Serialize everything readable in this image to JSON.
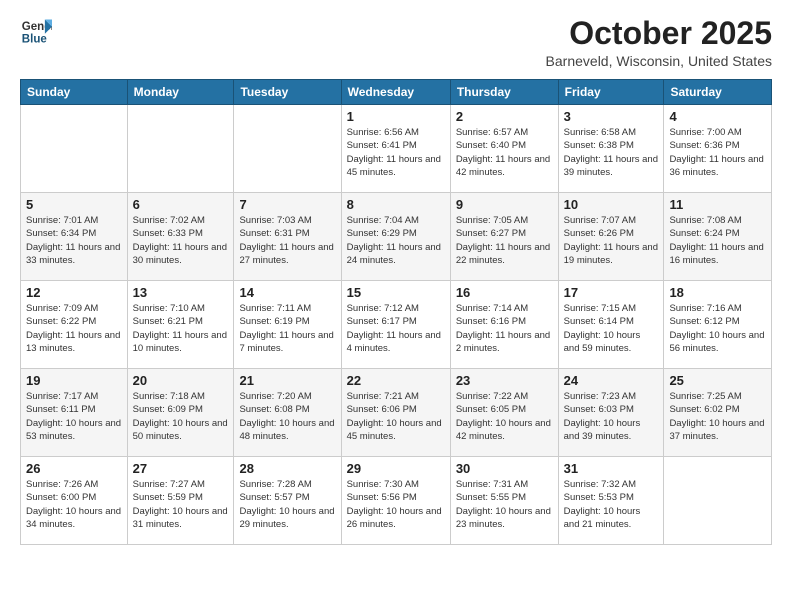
{
  "header": {
    "logo_general": "General",
    "logo_blue": "Blue",
    "month": "October 2025",
    "location": "Barneveld, Wisconsin, United States"
  },
  "days_of_week": [
    "Sunday",
    "Monday",
    "Tuesday",
    "Wednesday",
    "Thursday",
    "Friday",
    "Saturday"
  ],
  "weeks": [
    {
      "cells": [
        {
          "day": "",
          "info": ""
        },
        {
          "day": "",
          "info": ""
        },
        {
          "day": "",
          "info": ""
        },
        {
          "day": "1",
          "info": "Sunrise: 6:56 AM\nSunset: 6:41 PM\nDaylight: 11 hours and 45 minutes."
        },
        {
          "day": "2",
          "info": "Sunrise: 6:57 AM\nSunset: 6:40 PM\nDaylight: 11 hours and 42 minutes."
        },
        {
          "day": "3",
          "info": "Sunrise: 6:58 AM\nSunset: 6:38 PM\nDaylight: 11 hours and 39 minutes."
        },
        {
          "day": "4",
          "info": "Sunrise: 7:00 AM\nSunset: 6:36 PM\nDaylight: 11 hours and 36 minutes."
        }
      ]
    },
    {
      "cells": [
        {
          "day": "5",
          "info": "Sunrise: 7:01 AM\nSunset: 6:34 PM\nDaylight: 11 hours and 33 minutes."
        },
        {
          "day": "6",
          "info": "Sunrise: 7:02 AM\nSunset: 6:33 PM\nDaylight: 11 hours and 30 minutes."
        },
        {
          "day": "7",
          "info": "Sunrise: 7:03 AM\nSunset: 6:31 PM\nDaylight: 11 hours and 27 minutes."
        },
        {
          "day": "8",
          "info": "Sunrise: 7:04 AM\nSunset: 6:29 PM\nDaylight: 11 hours and 24 minutes."
        },
        {
          "day": "9",
          "info": "Sunrise: 7:05 AM\nSunset: 6:27 PM\nDaylight: 11 hours and 22 minutes."
        },
        {
          "day": "10",
          "info": "Sunrise: 7:07 AM\nSunset: 6:26 PM\nDaylight: 11 hours and 19 minutes."
        },
        {
          "day": "11",
          "info": "Sunrise: 7:08 AM\nSunset: 6:24 PM\nDaylight: 11 hours and 16 minutes."
        }
      ]
    },
    {
      "cells": [
        {
          "day": "12",
          "info": "Sunrise: 7:09 AM\nSunset: 6:22 PM\nDaylight: 11 hours and 13 minutes."
        },
        {
          "day": "13",
          "info": "Sunrise: 7:10 AM\nSunset: 6:21 PM\nDaylight: 11 hours and 10 minutes."
        },
        {
          "day": "14",
          "info": "Sunrise: 7:11 AM\nSunset: 6:19 PM\nDaylight: 11 hours and 7 minutes."
        },
        {
          "day": "15",
          "info": "Sunrise: 7:12 AM\nSunset: 6:17 PM\nDaylight: 11 hours and 4 minutes."
        },
        {
          "day": "16",
          "info": "Sunrise: 7:14 AM\nSunset: 6:16 PM\nDaylight: 11 hours and 2 minutes."
        },
        {
          "day": "17",
          "info": "Sunrise: 7:15 AM\nSunset: 6:14 PM\nDaylight: 10 hours and 59 minutes."
        },
        {
          "day": "18",
          "info": "Sunrise: 7:16 AM\nSunset: 6:12 PM\nDaylight: 10 hours and 56 minutes."
        }
      ]
    },
    {
      "cells": [
        {
          "day": "19",
          "info": "Sunrise: 7:17 AM\nSunset: 6:11 PM\nDaylight: 10 hours and 53 minutes."
        },
        {
          "day": "20",
          "info": "Sunrise: 7:18 AM\nSunset: 6:09 PM\nDaylight: 10 hours and 50 minutes."
        },
        {
          "day": "21",
          "info": "Sunrise: 7:20 AM\nSunset: 6:08 PM\nDaylight: 10 hours and 48 minutes."
        },
        {
          "day": "22",
          "info": "Sunrise: 7:21 AM\nSunset: 6:06 PM\nDaylight: 10 hours and 45 minutes."
        },
        {
          "day": "23",
          "info": "Sunrise: 7:22 AM\nSunset: 6:05 PM\nDaylight: 10 hours and 42 minutes."
        },
        {
          "day": "24",
          "info": "Sunrise: 7:23 AM\nSunset: 6:03 PM\nDaylight: 10 hours and 39 minutes."
        },
        {
          "day": "25",
          "info": "Sunrise: 7:25 AM\nSunset: 6:02 PM\nDaylight: 10 hours and 37 minutes."
        }
      ]
    },
    {
      "cells": [
        {
          "day": "26",
          "info": "Sunrise: 7:26 AM\nSunset: 6:00 PM\nDaylight: 10 hours and 34 minutes."
        },
        {
          "day": "27",
          "info": "Sunrise: 7:27 AM\nSunset: 5:59 PM\nDaylight: 10 hours and 31 minutes."
        },
        {
          "day": "28",
          "info": "Sunrise: 7:28 AM\nSunset: 5:57 PM\nDaylight: 10 hours and 29 minutes."
        },
        {
          "day": "29",
          "info": "Sunrise: 7:30 AM\nSunset: 5:56 PM\nDaylight: 10 hours and 26 minutes."
        },
        {
          "day": "30",
          "info": "Sunrise: 7:31 AM\nSunset: 5:55 PM\nDaylight: 10 hours and 23 minutes."
        },
        {
          "day": "31",
          "info": "Sunrise: 7:32 AM\nSunset: 5:53 PM\nDaylight: 10 hours and 21 minutes."
        },
        {
          "day": "",
          "info": ""
        }
      ]
    }
  ]
}
